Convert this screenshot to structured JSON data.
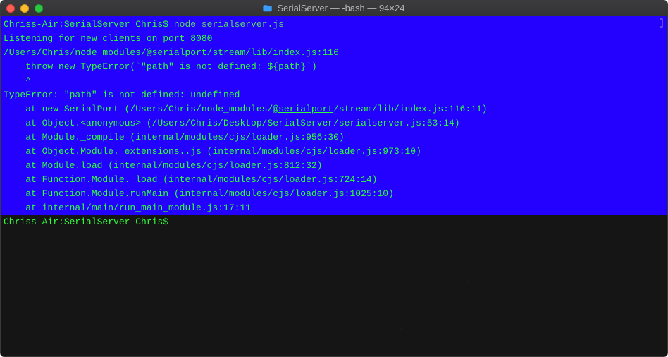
{
  "window": {
    "title": "SerialServer — -bash — 94×24"
  },
  "terminal": {
    "prompt1_host": "Chriss-Air:SerialServer Chris$ ",
    "prompt1_cmd": "node serialserver.js",
    "l2": "Listening for new clients on port 8080",
    "l3": "/Users/Chris/node_modules/@serialport/stream/lib/index.js:116",
    "l4": "    throw new TypeError(`\"path\" is not defined: ${path}`)",
    "l5": "    ^",
    "l6": "",
    "l7": "TypeError: \"path\" is not defined: undefined",
    "l8a": "    at new SerialPort (/Users/Chris/node_modules/",
    "l8link": "@serialport",
    "l8b": "/stream/lib/index.js:116:11)",
    "l9": "    at Object.<anonymous> (/Users/Chris/Desktop/SerialServer/serialserver.js:53:14)",
    "l10": "    at Module._compile (internal/modules/cjs/loader.js:956:30)",
    "l11": "    at Object.Module._extensions..js (internal/modules/cjs/loader.js:973:10)",
    "l12": "    at Module.load (internal/modules/cjs/loader.js:812:32)",
    "l13": "    at Function.Module._load (internal/modules/cjs/loader.js:724:14)",
    "l14": "    at Function.Module.runMain (internal/modules/cjs/loader.js:1025:10)",
    "l15": "    at internal/main/run_main_module.js:17:11",
    "prompt2": "Chriss-Air:SerialServer Chris$ ",
    "right_bracket": "]"
  }
}
